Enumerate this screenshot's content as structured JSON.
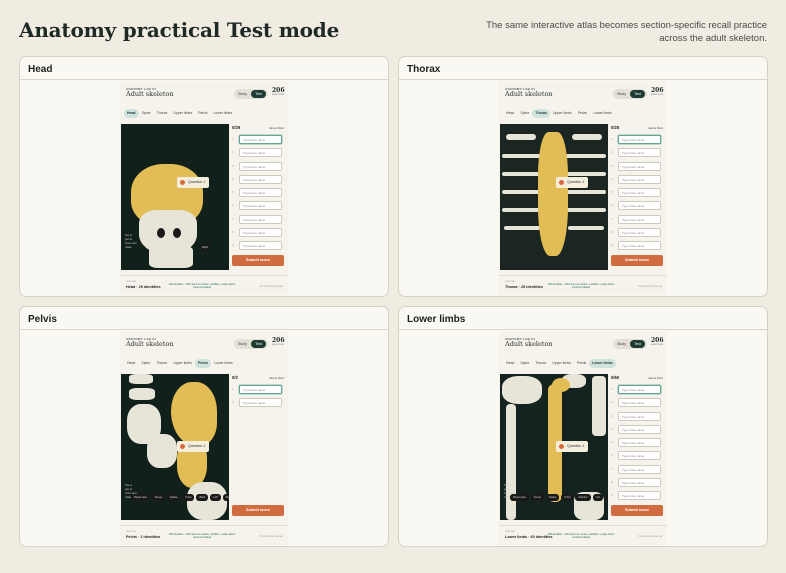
{
  "page": {
    "title": "Anatomy practical Test mode",
    "subtitle": "The same interactive atlas becomes section-specific recall practice across the adult skeleton."
  },
  "app": {
    "eyebrow": "ANATOMY LAB 01",
    "title": "Adult skeleton",
    "mode_study": "Study",
    "mode_test": "Test",
    "count": "206",
    "count_label": "IDENTITIES",
    "tabs": [
      "Head",
      "Spine",
      "Thorax",
      "Upper limbs",
      "Pelvis",
      "Lower limbs"
    ],
    "labels_filled": "labels filled",
    "answer_placeholder": "Type bone name",
    "submit_label": "Submit score",
    "footer_caption": "TEST SET",
    "footer_note": "206 identities · 206 canon in resolve, canflited · judge drawn controls isolated",
    "footer_right": "No current test set yet"
  },
  "panels": [
    {
      "heading": "Head",
      "active_tab": "Head",
      "progress": "0/29",
      "question": "Question 1",
      "footer_set": "Head · 29 identities",
      "stage_note": "Tap or pan to zoom and rotate",
      "view_buttons": [
        "Right"
      ]
    },
    {
      "heading": "Thorax",
      "active_tab": "Thorax",
      "progress": "0/25",
      "question": "Question 1",
      "footer_set": "Thorax · 25 identities",
      "stage_note": "",
      "view_buttons": []
    },
    {
      "heading": "Pelvis",
      "active_tab": "Pelvis",
      "progress": "0/2",
      "question": "Question 1",
      "footer_set": "Pelvis · 2 identities",
      "stage_note": "Tap or pan to zoom and rotate",
      "view_buttons": [
        "Reset view",
        "Focus",
        "Isolate",
        "Front",
        "Back",
        "Left",
        "Right"
      ]
    },
    {
      "heading": "Lower limbs",
      "active_tab": "Lower limbs",
      "progress": "0/60",
      "question": "Question 1",
      "footer_set": "Lower limbs · 60 identities",
      "stage_note": "Tap or pan to zoom and rotate",
      "view_buttons": [
        "Reset view",
        "Focus",
        "Isolate",
        "Front",
        "Anterior",
        "Left",
        "Right"
      ]
    }
  ],
  "colors": {
    "background": "#f1ece2",
    "accent_test": "#1e3a33",
    "submit": "#d16c40",
    "highlight_bone": "#e2bd55",
    "stage_bg": "#0f1b18"
  }
}
